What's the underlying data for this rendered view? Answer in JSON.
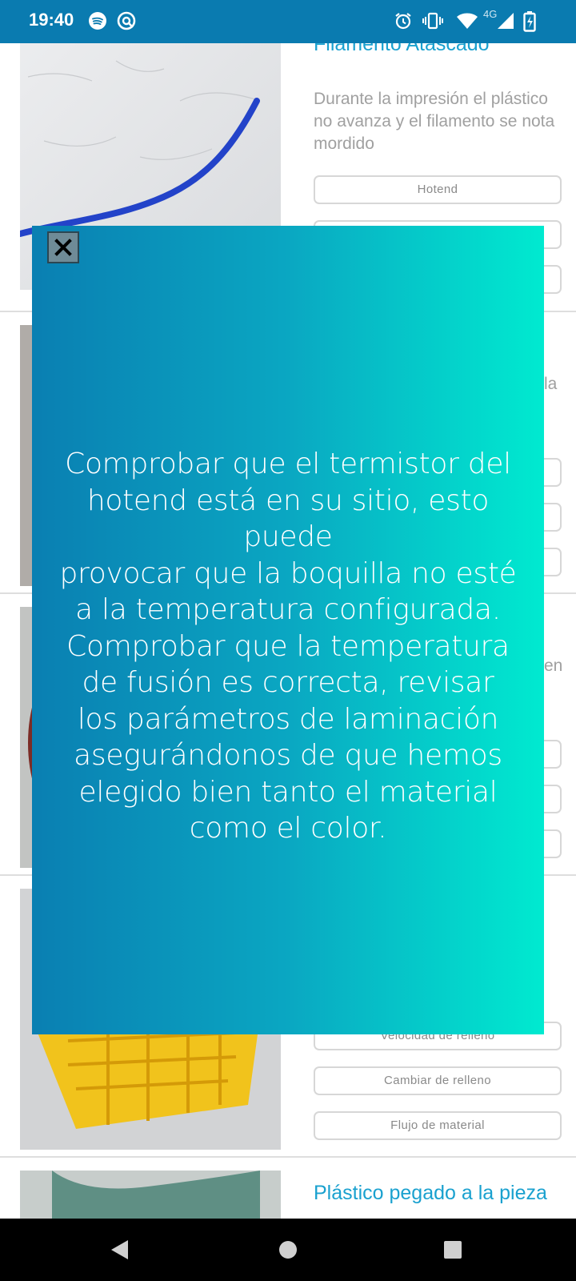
{
  "status_bar": {
    "time": "19:40",
    "network": "4G",
    "left_icons": [
      "spotify-icon",
      "cast-icon"
    ],
    "right_icons": [
      "alarm-icon",
      "vibrate-icon",
      "wifi-icon",
      "signal-icon",
      "battery-charging-icon"
    ]
  },
  "list": {
    "items": [
      {
        "title": "Filamento Atascado",
        "description": "Durante la impresión el plástico no avanza y el filamento se nota mordido",
        "buttons": [
          "Hotend",
          "",
          ""
        ]
      },
      {
        "title": "",
        "description": "la",
        "buttons": [
          "",
          "",
          ""
        ]
      },
      {
        "title": "",
        "description": "en",
        "buttons": [
          "",
          "",
          ""
        ]
      },
      {
        "title": "",
        "description": "",
        "buttons": [
          "Velocidad de relleno",
          "Cambiar de relleno",
          "Flujo de material"
        ]
      },
      {
        "title": "Plástico pegado a la pieza",
        "description": "",
        "buttons": []
      }
    ]
  },
  "modal": {
    "close_icon": "close-icon",
    "text": "Comprobar que el termistor del\nhotend está en su sitio, esto puede\nprovocar que la boquilla no esté\na la temperatura configurada.\nComprobar que la temperatura\nde fusión es correcta, revisar\nlos parámetros de laminación\nasegurándonos de que hemos\nelegido bien tanto el material\ncomo el color.",
    "gradient": [
      "#0a7fb2",
      "#00ead0"
    ]
  },
  "nav_bar": {
    "icons": [
      "back-icon",
      "home-icon",
      "recents-icon"
    ]
  },
  "colors": {
    "status_bar": "#0a7bb0",
    "accent_title": "#1aa1cf",
    "muted_text": "#a0a0a0"
  }
}
